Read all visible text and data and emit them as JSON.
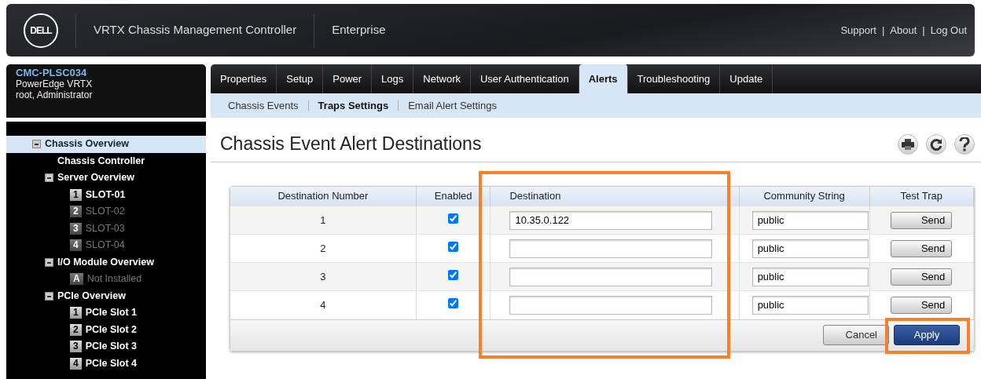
{
  "header": {
    "logo": "DELL",
    "title": "VRTX Chassis Management Controller",
    "edition": "Enterprise",
    "links": [
      "Support",
      "About",
      "Log Out"
    ],
    "separators": [
      "|",
      "|"
    ]
  },
  "sidebar": {
    "host": "CMC-PLSC034",
    "model": "PowerEdge VRTX",
    "user": "root, Administrator",
    "tree": [
      {
        "label": "Chassis Overview",
        "selected": true,
        "disabled": false,
        "expanded": true,
        "children": [
          {
            "label": "Chassis Controller",
            "selected": false,
            "disabled": false
          },
          {
            "label": "Server Overview",
            "selected": false,
            "disabled": false,
            "expanded": true,
            "children": [
              {
                "badge": "1",
                "label": "SLOT-01",
                "selected": false,
                "disabled": false
              },
              {
                "badge": "2",
                "label": "SLOT-02",
                "selected": false,
                "disabled": true
              },
              {
                "badge": "3",
                "label": "SLOT-03",
                "selected": false,
                "disabled": true
              },
              {
                "badge": "4",
                "label": "SLOT-04",
                "selected": false,
                "disabled": true
              }
            ]
          },
          {
            "label": "I/O Module Overview",
            "selected": false,
            "disabled": false,
            "expanded": true,
            "children": [
              {
                "badge": "A",
                "label": "Not Installed",
                "selected": false,
                "disabled": true
              }
            ]
          },
          {
            "label": "PCIe Overview",
            "selected": false,
            "disabled": false,
            "expanded": true,
            "children": [
              {
                "badge": "1",
                "label": "PCIe Slot 1",
                "selected": false,
                "disabled": false
              },
              {
                "badge": "2",
                "label": "PCIe Slot 2",
                "selected": false,
                "disabled": false
              },
              {
                "badge": "3",
                "label": "PCIe Slot 3",
                "selected": false,
                "disabled": false
              },
              {
                "badge": "4",
                "label": "PCIe Slot 4",
                "selected": false,
                "disabled": false
              }
            ]
          }
        ]
      }
    ]
  },
  "tabs": [
    {
      "label": "Properties",
      "selected": false
    },
    {
      "label": "Setup",
      "selected": false
    },
    {
      "label": "Power",
      "selected": false
    },
    {
      "label": "Logs",
      "selected": false
    },
    {
      "label": "Network",
      "selected": false
    },
    {
      "label": "User Authentication",
      "selected": false
    },
    {
      "label": "Alerts",
      "selected": true
    },
    {
      "label": "Troubleshooting",
      "selected": false
    },
    {
      "label": "Update",
      "selected": false
    }
  ],
  "subtabs": [
    {
      "label": "Chassis Events",
      "selected": false
    },
    {
      "label": "Traps Settings",
      "selected": true
    },
    {
      "label": "Email Alert Settings",
      "selected": false
    }
  ],
  "page_title": "Chassis Event Alert Destinations",
  "table": {
    "columns": [
      {
        "label": "Destination Number",
        "highlighted": false
      },
      {
        "label": "Enabled",
        "highlighted": false
      },
      {
        "label": "Destination",
        "highlighted": true
      },
      {
        "label": "Community String",
        "highlighted": false
      },
      {
        "label": "Test Trap",
        "highlighted": false
      }
    ],
    "rows": [
      {
        "number": "1",
        "enabled": true,
        "destination": "10.35.0.122",
        "community": "public",
        "button": "Send"
      },
      {
        "number": "2",
        "enabled": true,
        "destination": "",
        "community": "public",
        "button": "Send"
      },
      {
        "number": "3",
        "enabled": true,
        "destination": "",
        "community": "public",
        "button": "Send"
      },
      {
        "number": "4",
        "enabled": true,
        "destination": "",
        "community": "public",
        "button": "Send"
      }
    ]
  },
  "footer_buttons": [
    {
      "label": "Cancel",
      "kind": "secondary",
      "highlighted": false
    },
    {
      "label": "Apply",
      "kind": "primary",
      "highlighted": true
    }
  ]
}
